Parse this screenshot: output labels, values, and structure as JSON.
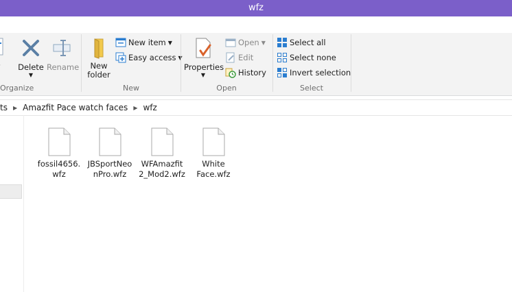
{
  "window": {
    "title": "wfz"
  },
  "ribbon": {
    "organize": {
      "label": "Organize",
      "copy_partial": "y",
      "delete_label": "Delete",
      "rename_label": "Rename"
    },
    "new": {
      "label": "New",
      "new_folder_line1": "New",
      "new_folder_line2": "folder",
      "new_item_label": "New item",
      "easy_access_label": "Easy access"
    },
    "open": {
      "label": "Open",
      "properties_label": "Properties",
      "open_label": "Open",
      "edit_label": "Edit",
      "history_label": "History"
    },
    "select": {
      "label": "Select",
      "select_all_label": "Select all",
      "select_none_label": "Select none",
      "invert_selection_label": "Invert selection"
    }
  },
  "address": {
    "crumbs": [
      "ts",
      "Amazfit Pace watch faces",
      "wfz"
    ]
  },
  "files": [
    {
      "name": "fossil4656.wfz"
    },
    {
      "name": "JBSportNeonPro.wfz"
    },
    {
      "name": "WFAmazfit2_Mod2.wfz"
    },
    {
      "name": "White Face.wfz"
    }
  ],
  "colors": {
    "titlebar": "#7b5fc9",
    "ribbon_bg": "#f3f3f3",
    "icon_blue": "#2a7dd0",
    "folder_yellow": "#f2c94c"
  }
}
